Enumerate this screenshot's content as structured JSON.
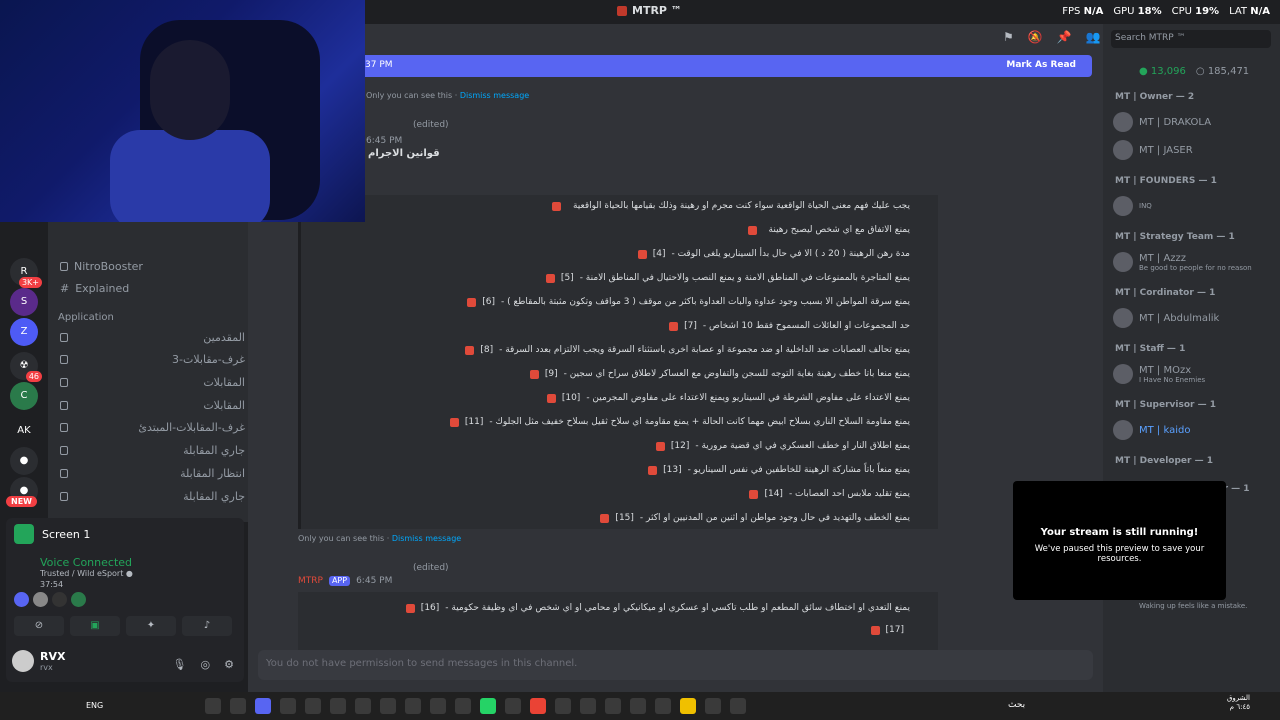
{
  "titlebar": {
    "title": "MTRP ™",
    "fps_label": "FPS",
    "fps": "N/A",
    "gpu_label": "GPU",
    "gpu": "18%",
    "cpu_label": "CPU",
    "cpu": "19%",
    "lat_label": "LAT",
    "lat": "N/A"
  },
  "servers": {
    "badge1": "3K+",
    "badge2": "46",
    "new": "NEW"
  },
  "channels": {
    "items": [
      {
        "label": "NitroBooster",
        "icon": "lock-icon"
      },
      {
        "label": "Explained",
        "icon": "hash-icon"
      }
    ],
    "category": "Application",
    "arabic": [
      "المقدمين",
      "غرف-مقابلات-3",
      "المقابلات",
      "المقابلات",
      "غرف-المقابلات-المبتدئ",
      "جاري المقابلة",
      "انتظار المقابلة",
      "جاري المقابلة"
    ]
  },
  "voice": {
    "screen": "Screen 1",
    "connected": "Voice Connected",
    "sub": "Trusted / Wild eSport ●",
    "time": "37:54",
    "user": "RVX",
    "user_tag": "rvx"
  },
  "main": {
    "banner_time": "37 PM",
    "banner_action": "Mark As Read",
    "only_you": "Only you can see this · ",
    "dismiss": "Dismiss message",
    "msg1_time": "6:45 PM",
    "msg1_edited": "(edited)",
    "title": "قوانين الاجرام",
    "rules": [
      {
        "num": "",
        "text": "يجب عليك فهم معنى الحياة الواقعية سواء كنت مجرم او رهينة وذلك بقيامها بالحياة الواقعية"
      },
      {
        "num": "",
        "text": "يمنع الاتفاق مع اي شخص ليصبح رهينة"
      },
      {
        "num": "[4]",
        "text": "مدة رهن الرهينة ( 20 د ) الا في حال بدأ السيناريو يلغى الوقت -"
      },
      {
        "num": "[5]",
        "text": "يمنع المتاجرة بالممنوعات في المناطق الامنة و يمنع النصب والاحتيال في المناطق الامنة -"
      },
      {
        "num": "[6]",
        "text": "يمنع سرقة المواطن الا بسبب وجود عداوة والبات العداوة باكثر من موقف ( 3 مواقف وتكون مثبتة بالمقاطع ) -"
      },
      {
        "num": "[7]",
        "text": "حد المجموعات او العائلات المسموح فقط 10 اشخاص -"
      },
      {
        "num": "[8]",
        "text": "يمنع تحالف العصابات ضد الداخلية او ضد مجموعة او عصابة اخرى باستثناء السرقة ويجب الالتزام بعدد السرقة -"
      },
      {
        "num": "[9]",
        "text": "يمنع منعا باتا خطف رهينة بغاية التوجه للسجن والتفاوض مع العساكر لاطلاق سراح اي سجين -"
      },
      {
        "num": "[10]",
        "text": "يمنع الاعتداء على مفاوض الشرطة في السيناريو ويمنع الاعتداء على مفاوض المجرمين -"
      },
      {
        "num": "[11]",
        "text": "يمنع مقاومة السلاح الناري بسلاح ابيض مهما كانت الحالة + يمنع مقاومة اي سلاح ثقيل بسلاح خفيف مثل الجلوك -"
      },
      {
        "num": "[12]",
        "text": "يمنع اطلاق النار او خطف العسكري في اي قضية مرورية -"
      },
      {
        "num": "[13]",
        "text": "يمنع منعاً باتاً مشاركة الرهينة للخاطفين في نفس السيناريو -"
      },
      {
        "num": "[14]",
        "text": "يمنع تقليد ملابس احد العصابات -"
      },
      {
        "num": "[15]",
        "text": "يمنع الخطف والتهديد في حال وجود مواطن او اثنين من المدنيين او اكثر -"
      }
    ],
    "only_you2": "Only you can see this · ",
    "dismiss2": "Dismiss message",
    "msg2_user": "MTRP",
    "msg2_app": "APP",
    "msg2_time": "6:45 PM",
    "msg2_edited": "(edited)",
    "rules2": [
      {
        "num": "[16]",
        "text": "يمنع التعدي او اختطاف سائق المطعم او طلب تاكسي او عسكري او ميكانيكي او محامي او اي شخص في اي وظيفة حكومية -"
      },
      {
        "num": "[17]",
        "text": ""
      }
    ],
    "composer": "You do not have permission to send messages in this channel."
  },
  "members": {
    "search": "Search MTRP ™",
    "online": "13,096",
    "total": "185,471",
    "groups": [
      {
        "role": "MT | Owner — 2",
        "members": [
          {
            "name": "MT | DRAKOLA",
            "sub": ""
          },
          {
            "name": "MT | JASER",
            "sub": ""
          }
        ]
      },
      {
        "role": "MT | FOUNDERS — 1",
        "members": [
          {
            "name": "",
            "sub": "INQ"
          }
        ]
      },
      {
        "role": "MT | Strategy Team — 1",
        "members": [
          {
            "name": "MT | Azzz",
            "sub": "Be good to people for no reason"
          }
        ]
      },
      {
        "role": "MT | Cordinator — 1",
        "members": [
          {
            "name": "MT | Abdulmalik",
            "sub": ""
          }
        ]
      },
      {
        "role": "MT | Staff — 1",
        "members": [
          {
            "name": "MT | MOzx",
            "sub": "I Have No Enemies"
          }
        ]
      },
      {
        "role": "MT | Supervisor — 1",
        "members": [
          {
            "name": "MT | kaido",
            "sub": ""
          }
        ]
      },
      {
        "role": "MT | Developer — 1",
        "members": []
      },
      {
        "role": "MT | Content manager — 1",
        "members": [
          {
            "name": "MT | EAGLE",
            "sub": ""
          }
        ]
      }
    ],
    "waking": "Waking up feels like a mistake.",
    "toast_title": "Your stream is still running!",
    "toast_body": "We've paused this preview to save your resources."
  },
  "taskbar": {
    "lang": "ENG",
    "search": "بحث",
    "date_left": "٦:٤٥ م\n٢٧/٨/٢٤",
    "date_right": "٦:٤٥ م",
    "region": "الشروق"
  }
}
